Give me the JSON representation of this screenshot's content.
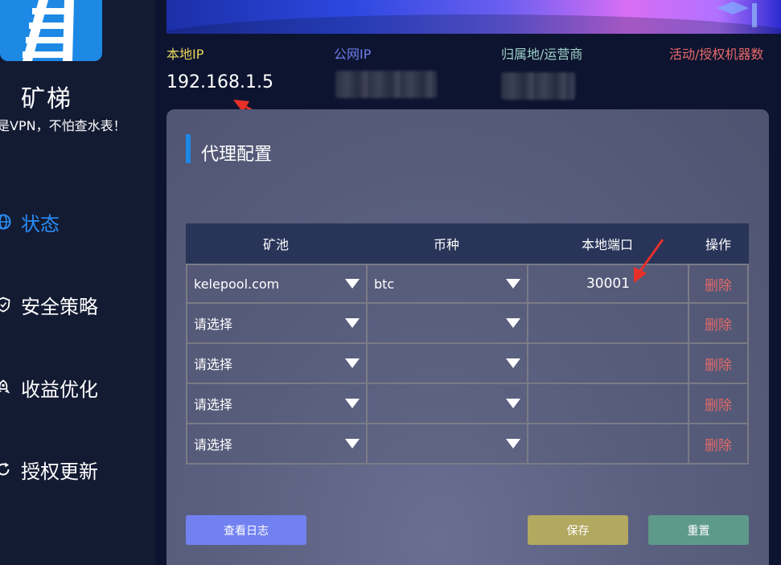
{
  "app": {
    "name": "矿梯",
    "slogan": "是VPN，不怕查水表！"
  },
  "sidebar": {
    "items": [
      {
        "label": "状态",
        "icon": "globe-icon",
        "active": true
      },
      {
        "label": "安全策略",
        "icon": "shield-icon",
        "active": false
      },
      {
        "label": "收益优化",
        "icon": "rocket-icon",
        "active": false
      },
      {
        "label": "授权更新",
        "icon": "refresh-icon",
        "active": false
      }
    ]
  },
  "info": {
    "local_ip_label": "本地IP",
    "local_ip_value": "192.168.1.5",
    "public_ip_label": "公网IP",
    "location_label": "归属地/运营商",
    "machines_label": "活动/授权机器数"
  },
  "colors": {
    "local_ip_label": "#e6d35a",
    "public_ip_label": "#6f7de8",
    "location_label": "#9fd4c8",
    "machines_label": "#e86a6a",
    "accent": "#1e88e5"
  },
  "panel": {
    "title": "代理配置"
  },
  "table": {
    "headers": [
      "矿池",
      "币种",
      "本地端口",
      "操作"
    ],
    "rows": [
      {
        "pool": "kelepool.com",
        "coin": "btc",
        "port": "30001",
        "action": "删除"
      },
      {
        "pool": "请选择",
        "coin": "",
        "port": "",
        "action": "删除"
      },
      {
        "pool": "请选择",
        "coin": "",
        "port": "",
        "action": "删除"
      },
      {
        "pool": "请选择",
        "coin": "",
        "port": "",
        "action": "删除"
      },
      {
        "pool": "请选择",
        "coin": "",
        "port": "",
        "action": "删除"
      }
    ]
  },
  "buttons": {
    "view_log": "查看日志",
    "save": "保存",
    "reset": "重置"
  }
}
